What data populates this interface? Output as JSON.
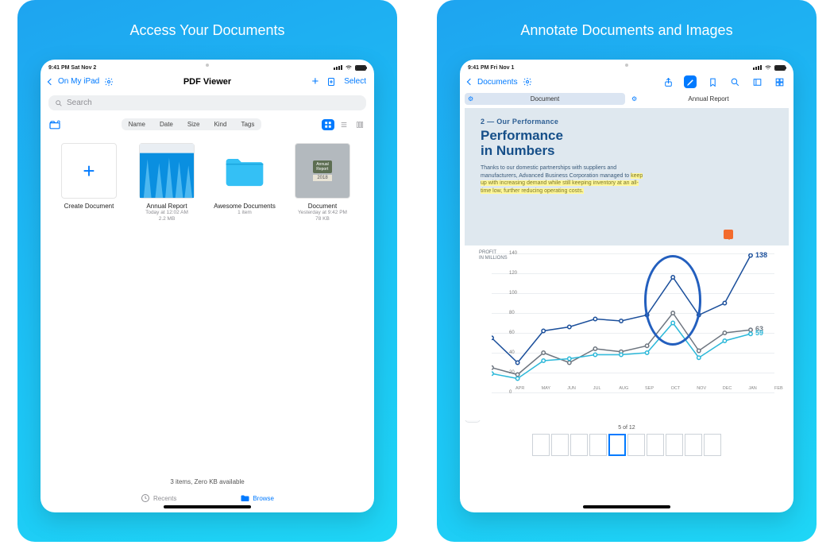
{
  "cards": {
    "left_title": "Access Your Documents",
    "right_title": "Annotate Documents and Images"
  },
  "left": {
    "status": {
      "time_date": "9:41 PM  Sat Nov 2"
    },
    "nav": {
      "back": "On My iPad",
      "title": "PDF Viewer",
      "select": "Select"
    },
    "search_placeholder": "Search",
    "sort": {
      "name": "Name",
      "date": "Date",
      "size": "Size",
      "kind": "Kind",
      "tags": "Tags"
    },
    "items": [
      {
        "name": "Create Document",
        "meta1": "",
        "meta2": ""
      },
      {
        "name": "Annual Report",
        "meta1": "Today at 12:02 AM",
        "meta2": "2.2 MB"
      },
      {
        "name": "Awesome Documents",
        "meta1": "1 item",
        "meta2": ""
      },
      {
        "name": "Document",
        "meta1": "Yesterday at 9:42 PM",
        "meta2": "78 KB"
      }
    ],
    "doc_thumb_year": "2018",
    "footer": "3 items, Zero KB available",
    "tabs": {
      "recents": "Recents",
      "browse": "Browse"
    }
  },
  "right": {
    "status": {
      "time_date": "9:41 PM  Fri Nov 1"
    },
    "nav_back": "Documents",
    "doc_tabs": {
      "a": "Document",
      "b": "Annual Report"
    },
    "section_label": "2 — Our Performance",
    "title_l1": "Performance",
    "title_l2": "in Numbers",
    "para_pre": "Thanks to our domestic partnerships with suppliers and manufacturers, Advanced Business Corporation managed to ",
    "para_hl": "keep up with increasing demand while still keeping inventory at an all-time low, further reducing operating costs.",
    "chart_ylabel_l1": "PROFIT",
    "chart_ylabel_l2": "IN MILLIONS",
    "end_labels": {
      "top": "138",
      "mid": "63",
      "bot": "59"
    },
    "page_count": "5 of 12"
  },
  "colors": {
    "blue": "#007aff",
    "series_dark": "#1b4f9b",
    "series_grey": "#6e7680",
    "series_cyan": "#2cb8d9"
  },
  "chart_data": {
    "type": "line",
    "x": [
      "APR",
      "MAY",
      "JUN",
      "JUL",
      "AUG",
      "SEP",
      "OCT",
      "NOV",
      "DEC",
      "JAN",
      "FEB"
    ],
    "ylim": [
      0,
      140
    ],
    "yticks": [
      0,
      20,
      40,
      60,
      80,
      100,
      120,
      140
    ],
    "ylabel": "PROFIT IN MILLIONS",
    "series": [
      {
        "name": "dark",
        "color": "#1b4f9b",
        "values": [
          55,
          30,
          62,
          66,
          74,
          72,
          78,
          116,
          78,
          90,
          138
        ],
        "end_label": 138
      },
      {
        "name": "grey",
        "color": "#6e7680",
        "values": [
          25,
          18,
          40,
          30,
          44,
          41,
          47,
          80,
          42,
          60,
          63
        ],
        "end_label": 63
      },
      {
        "name": "cyan",
        "color": "#2cb8d9",
        "values": [
          19,
          14,
          32,
          34,
          38,
          38,
          40,
          70,
          35,
          52,
          59
        ],
        "end_label": 59
      }
    ],
    "annotation_circle_center_x": "NOV"
  }
}
